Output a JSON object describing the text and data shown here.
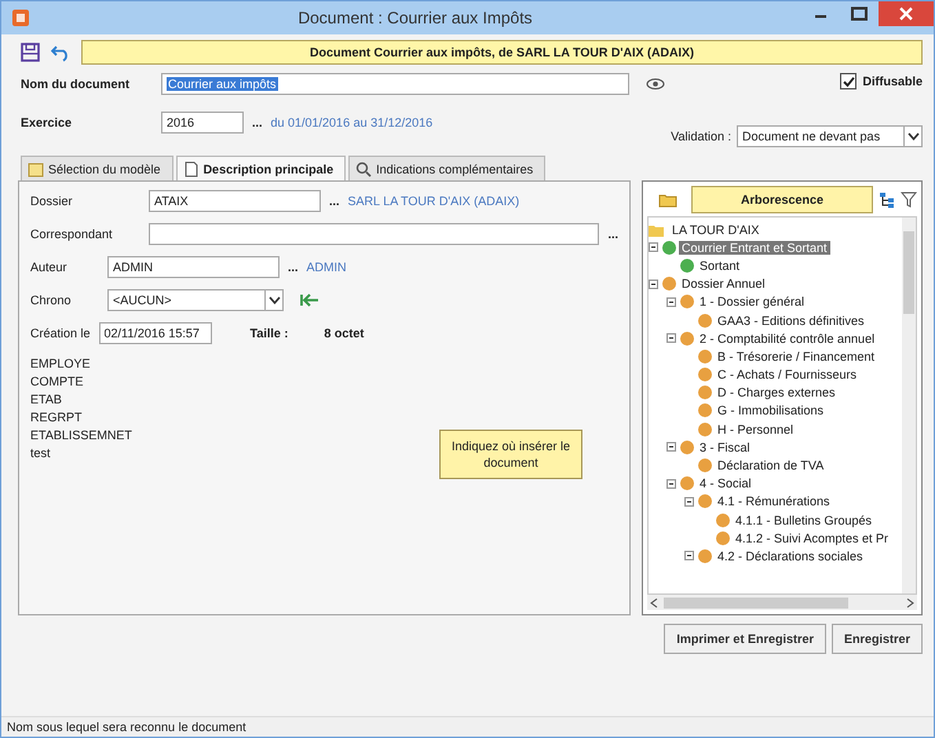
{
  "window": {
    "title": "Document : Courrier aux Impôts"
  },
  "banner": "Document Courrier aux impôts, de SARL LA TOUR D'AIX (ADAIX)",
  "document_name": {
    "label": "Nom du document",
    "value": "Courrier aux impôts",
    "text_selected": true
  },
  "diffusable": {
    "label": "Diffusable",
    "checked": true
  },
  "exercise": {
    "label": "Exercice",
    "value": "2016",
    "browse": "...",
    "period": "du 01/01/2016 au 31/12/2016"
  },
  "validation": {
    "label": "Validation :",
    "value": "Document ne devant pas"
  },
  "tabs": [
    {
      "label": "Sélection du modèle",
      "selected": false
    },
    {
      "label": "Description principale",
      "selected": true
    },
    {
      "label": "Indications complémentaires",
      "selected": false
    }
  ],
  "dossier": {
    "label": "Dossier",
    "value": "ATAIX",
    "browse": "...",
    "link": "SARL LA TOUR D'AIX (ADAIX)"
  },
  "correspondant": {
    "label": "Correspondant",
    "browse": "..."
  },
  "auteur": {
    "label": "Auteur",
    "value": "ADMIN",
    "browse": "...",
    "link": "ADMIN"
  },
  "chrono": {
    "label": "Chrono",
    "value": "<AUCUN>"
  },
  "creation": {
    "label": "Création le",
    "value": "02/11/2016 15:57",
    "size_label": "Taille :",
    "size": "8 octet"
  },
  "keywords": [
    "EMPLOYE",
    "COMPTE",
    "ETAB",
    "REGRPT",
    "ETABLISSEMNET",
    "test"
  ],
  "tooltip": "Indiquez où insérer le document",
  "tree": {
    "header": "Arborescence",
    "root": "LA TOUR D'AIX",
    "nodes": [
      {
        "label": "Courrier Entrant et Sortant",
        "color": "#4caf50",
        "selected": true,
        "expanded": true,
        "children": [
          {
            "label": "Sortant",
            "color": "#4caf50",
            "selected": false
          }
        ]
      },
      {
        "label": "Dossier Annuel",
        "color": "#e8a040",
        "selected": false,
        "expanded": true,
        "children": [
          {
            "label": "1 - Dossier général",
            "color": "#e8a040",
            "selected": false,
            "expanded": true,
            "children": [
              {
                "label": "GAA3 - Editions définitives",
                "color": "#e8a040",
                "selected": false
              }
            ]
          },
          {
            "label": "2 - Comptabilité contrôle annuel",
            "color": "#e8a040",
            "selected": false,
            "expanded": true,
            "children": [
              {
                "label": "B - Trésorerie / Financement",
                "color": "#e8a040",
                "selected": false
              },
              {
                "label": "C - Achats / Fournisseurs",
                "color": "#e8a040",
                "selected": false
              },
              {
                "label": "D - Charges externes",
                "color": "#e8a040",
                "selected": false
              },
              {
                "label": "G - Immobilisations",
                "color": "#e8a040",
                "selected": false
              },
              {
                "label": "H - Personnel",
                "color": "#e8a040",
                "selected": false
              }
            ]
          },
          {
            "label": "3 - Fiscal",
            "color": "#e8a040",
            "selected": false,
            "expanded": true,
            "children": [
              {
                "label": "Déclaration de TVA",
                "color": "#e8a040",
                "selected": false
              }
            ]
          },
          {
            "label": "4 - Social",
            "color": "#e8a040",
            "selected": false,
            "expanded": true,
            "children": [
              {
                "label": "4.1 - Rémunérations",
                "color": "#e8a040",
                "selected": false,
                "expanded": true,
                "children": [
                  {
                    "label": "4.1.1 - Bulletins Groupés",
                    "color": "#e8a040",
                    "selected": false
                  },
                  {
                    "label": "4.1.2 - Suivi Acomptes et Pr",
                    "color": "#e8a040",
                    "selected": false
                  }
                ]
              },
              {
                "label": "4.2 - Déclarations sociales",
                "color": "#e8a040",
                "selected": false,
                "expanded": true
              }
            ]
          }
        ]
      }
    ]
  },
  "buttons": [
    "Imprimer et Enregistrer",
    "Enregistrer"
  ],
  "status_bar": "Nom sous lequel sera reconnu le document"
}
